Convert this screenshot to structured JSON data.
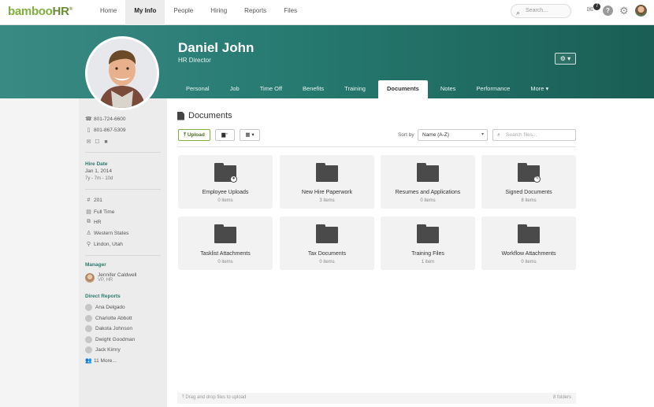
{
  "app": {
    "logo_text": "bamboo",
    "logo_suffix": "HR",
    "logo_mark": "®"
  },
  "topnav": {
    "items": [
      "Home",
      "My Info",
      "People",
      "Hiring",
      "Reports",
      "Files"
    ],
    "active": "My Info",
    "search_placeholder": "Search...",
    "notification_count": "7"
  },
  "employee": {
    "name": "Daniel John",
    "title": "HR Director"
  },
  "tabs": [
    "Personal",
    "Job",
    "Time Off",
    "Benefits",
    "Training",
    "Documents",
    "Notes",
    "Performance",
    "More ▾"
  ],
  "active_tab": "Documents",
  "sidebar": {
    "phones": [
      "801-724-6600",
      "801-867-5309"
    ],
    "hire_date_label": "Hire Date",
    "hire_date": "Jan 1, 2014",
    "tenure": "7y - 7m - 10d",
    "details": [
      "201",
      "Full Time",
      "HR",
      "Western States",
      "Lindon, Utah"
    ],
    "manager_label": "Manager",
    "manager_name": "Jennifer Caldwell",
    "manager_title": "VP, HR",
    "reports_label": "Direct Reports",
    "reports": [
      "Ana Delgado",
      "Charlotte Abbott",
      "Dakota Johnson",
      "Dwight Goodman",
      "Jack Kimry",
      "11 More..."
    ]
  },
  "documents": {
    "title": "Documents",
    "upload_label": "Upload",
    "sort_label": "Sort by",
    "sort_value": "Name (A-Z)",
    "search_placeholder": "Search files...",
    "folders": [
      {
        "name": "Employee Uploads",
        "count": "0 items",
        "badge": "person"
      },
      {
        "name": "New Hire Paperwork",
        "count": "3 items",
        "badge": ""
      },
      {
        "name": "Resumes and Applications",
        "count": "0 items",
        "badge": ""
      },
      {
        "name": "Signed Documents",
        "count": "8 items",
        "badge": "pen"
      },
      {
        "name": "Tasklist Attachments",
        "count": "0 items",
        "badge": ""
      },
      {
        "name": "Tax Documents",
        "count": "0 items",
        "badge": ""
      },
      {
        "name": "Training Files",
        "count": "1 item",
        "badge": ""
      },
      {
        "name": "Workflow Attachments",
        "count": "0 items",
        "badge": ""
      }
    ],
    "footer_hint": "Drag and drop files to upload",
    "footer_count": "8 folders"
  },
  "colors": {
    "header_teal": "#267a70",
    "accent_green": "#7fb03b",
    "sidebar_label": "#2d7a6e"
  }
}
